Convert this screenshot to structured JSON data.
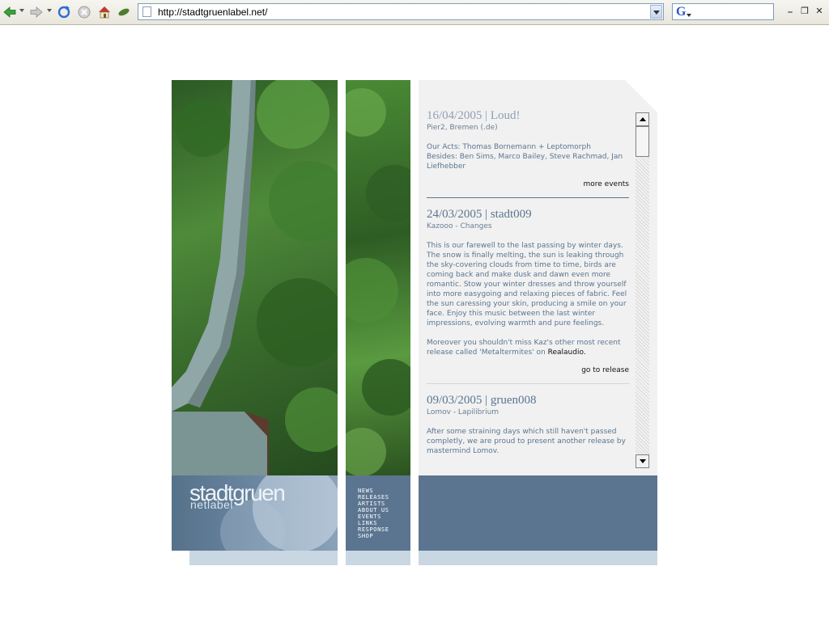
{
  "browser": {
    "url": "http://stadtgruenlabel.net/",
    "back_icon": "back-arrow-icon",
    "forward_icon": "forward-arrow-icon",
    "refresh_icon": "refresh-icon",
    "stop_icon": "stop-icon",
    "home_icon": "home-icon",
    "extra_icon": "leaf-icon",
    "search_icon": "google-search-icon",
    "minimize_glyph": "_",
    "restore_glyph": "❐",
    "close_glyph": "✕"
  },
  "site": {
    "logo_main": "stadtgruen",
    "logo_sub": "netlabel",
    "nav": [
      "NEWS",
      "RELEASES",
      "ARTISTS",
      "ABOUT US",
      "EVENTS",
      "LINKS",
      "RESPONSE",
      "SHOP"
    ],
    "colors": {
      "accent": "#5b7590",
      "light_blue": "#c9d7e2",
      "content_bg": "#f1f1f1"
    }
  },
  "news": [
    {
      "title": "16/04/2005 | Loud!",
      "subtitle": "Pier2, Bremen (.de)",
      "paragraphs": [
        "Our Acts: Thomas Bornemann + Leptomorph",
        "Besides: Ben Sims, Marco Bailey, Steve Rachmad, Jan Liefhebber"
      ],
      "link": "more events"
    },
    {
      "title": "24/03/2005 | stadt009",
      "subtitle": "Kazooo - Changes",
      "paragraphs": [
        "This is our farewell to the last passing by winter days. The snow is finally melting, the sun is leaking through the sky-covering clouds from time to time, birds are coming back and make dusk and dawn even more romantic. Stow your winter dresses and throw yourself into more easygoing and relaxing pieces of fabric. Feel the sun caressing your skin, producing a smile on your face. Enjoy this music between the last winter impressions, evolving warmth and pure feelings.",
        "Moreover you shouldn't miss Kaz's other most recent release called 'Metaltermites' on",
        "Realaudio."
      ],
      "link": "go to release"
    },
    {
      "title": "09/03/2005 | gruen008",
      "subtitle": "Lomov - Lapilibrium",
      "paragraphs": [
        "After some straining days which still haven't passed completly, we are proud to present another release by mastermind Lomov."
      ]
    }
  ]
}
